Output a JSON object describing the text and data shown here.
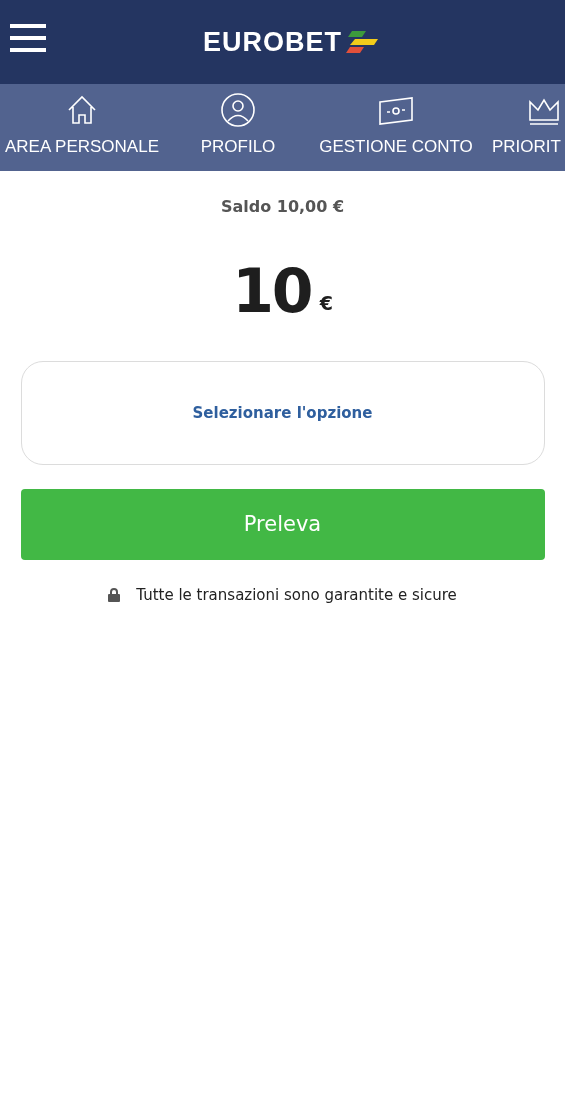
{
  "header": {
    "brand": "EUROBET"
  },
  "nav": [
    {
      "kind": "home",
      "label": "AREA PERSONALE"
    },
    {
      "kind": "profile",
      "label": "PROFILO"
    },
    {
      "kind": "money",
      "label": "GESTIONE CONTO"
    },
    {
      "kind": "crown",
      "label": "PRIORIT"
    }
  ],
  "balance": {
    "label": "Saldo",
    "value": "10,00 €"
  },
  "amount": {
    "value": "10",
    "currency": "€"
  },
  "option": {
    "placeholder": "Selezionare l'opzione"
  },
  "submit": "Preleva",
  "security_note": "Tutte le transazioni sono garantite e sicure"
}
